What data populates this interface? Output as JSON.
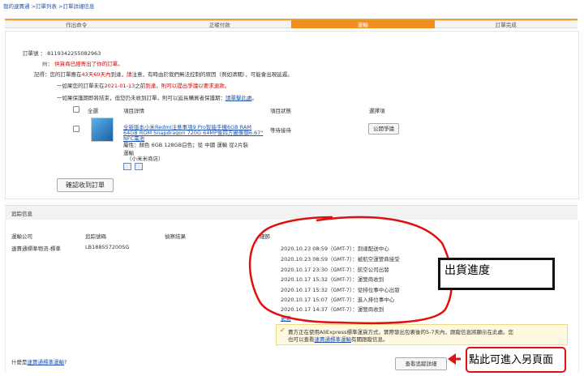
{
  "breadcrumb": {
    "text": "我的速賣通 >訂單列表 >訂單詳細信息"
  },
  "steps": [
    "作出命令",
    "正確付款",
    "運輸",
    "訂單完成"
  ],
  "order": {
    "number_label": "訂單號 ：",
    "number_value": "8119342255082963",
    "state_label": "州：",
    "state_value": "供貨商已經寄出了你的訂單。",
    "note_label": "記得：",
    "note_text_1": "您的訂單應在",
    "note_time": "43天60天內",
    "note_text_2": "到達，",
    "note_warn": "請",
    "note_text_3": "注意，有時由於我們無法控制的原因（例如清關），可能會出現延遲。",
    "line2_a": "一如果您的訂單未在",
    "line2_date": "2021-01-13",
    "line2_b": "之前",
    "line2_c": "到達，則可以提出爭議以要求退款。",
    "line3_a": "一如果保護期即將結束，但您仍未收到訂單，則可以延長購買者保護期：",
    "line3_link": "請單擊此處",
    "line3_end": "。"
  },
  "product_table": {
    "select_all": "全選",
    "col_details": "項目詳情",
    "col_status": "項目狀態",
    "col_option": "選擇項",
    "item_title": "全新版本小米Redmi注意事項9 Pro智能手機6GB RAM 64GB ROM Snapdragon 720G 64MP後四方攝像頭6.67\" NFC電池",
    "item_attrs": "屬性：顏色 6GB 128GB白色；從 中國 運輸 從2片裝",
    "item_attrs2": "運輸",
    "item_store": "（小米米商店）",
    "item_status": "等待接待",
    "dispute_button": "公開爭議",
    "confirm_button": "確認收到訂單"
  },
  "tracking": {
    "section_title": "追踪信息",
    "col_company": "運輸公司",
    "col_tracking": "追踪號碼",
    "col_result": "偵察結果",
    "col_details": "細節",
    "company": "速賣通標準物流-標準",
    "tracking_no": "LB188557200SG",
    "events": [
      "2020.10.23 08:59（GMT-7）：到達配送中心",
      "2020.10.23 08:59（GMT-7）：被航空運營商接受",
      "2020.10.17 23:30（GMT-7）：航空公司出發",
      "2020.10.17 15:32（GMT-7）：運營商收到",
      "2020.10.17 15:32（GMT-7）：從排位事中心出發",
      "2020.10.17 15:07（GMT-7）：進入排位事中心",
      "2020.10.17 14:37（GMT-7）：運營商收到"
    ],
    "more_link": "更新",
    "notice_1": "賣方正在使用AliExpress標準運貨方式，實際發出包裹後的5-7天內，跟蹤信息將顯示在此處。您",
    "notice_2": "也可以查看",
    "notice_link": "速賣通標準運輸",
    "notice_3": "有關跟蹤信息。",
    "footer_q": "什麼是",
    "footer_link": "速賣通標準運輸",
    "footer_end": "?",
    "view_button": "查看追蹤詳細"
  },
  "annotations": {
    "progress_label": "出貨進度",
    "click_label": "點此可進入另頁面"
  },
  "colors": {
    "accent": "#f08f1d",
    "link": "#2255aa",
    "warn": "#d40000",
    "anno": "#e01010"
  }
}
